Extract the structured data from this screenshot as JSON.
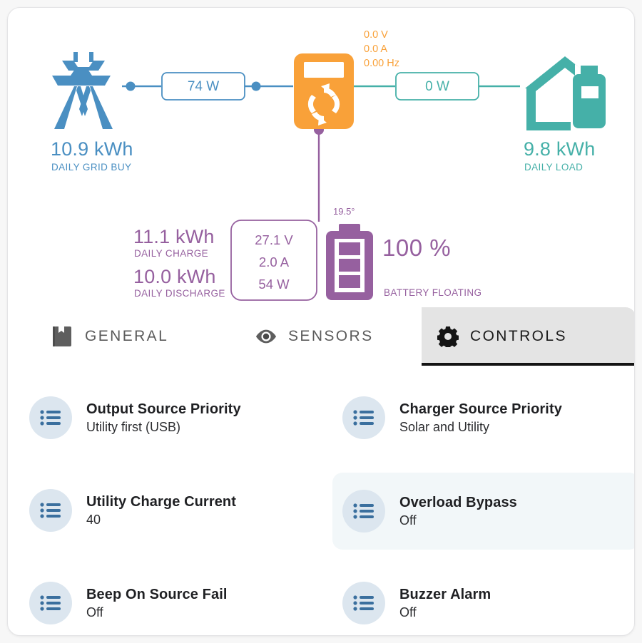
{
  "colors": {
    "grid": "#4a8fc2",
    "load": "#45b0a8",
    "battery": "#96609f",
    "inverter": "#f9a139",
    "icon_circle": "#dce6ef",
    "row_highlight": "#f2f7f9",
    "tab_active_bg": "#e4e4e4",
    "tab_underline": "#141414",
    "card_bg": "#ffffff",
    "page_bg": "#f7f7f7"
  },
  "diagram": {
    "grid": {
      "icon": "transmission-tower-icon",
      "value": "10.9 kWh",
      "caption": "DAILY GRID BUY",
      "flow_box": "74 W"
    },
    "inverter": {
      "icon": "inverter-icon",
      "ac_voltage": "0.0 V",
      "ac_current": "0.0 A",
      "ac_frequency": "0.00 Hz"
    },
    "load": {
      "icon": "house-load-icon",
      "value": "9.8 kWh",
      "caption": "DAILY LOAD",
      "flow_box": "0 W"
    },
    "battery": {
      "icon": "battery-icon",
      "daily_charge_value": "11.1 kWh",
      "daily_charge_caption": "DAILY CHARGE",
      "daily_discharge_value": "10.0 kWh",
      "daily_discharge_caption": "DAILY DISCHARGE",
      "voltage": "27.1 V",
      "current": "2.0 A",
      "power": "54 W",
      "temperature": "19.5°",
      "soc": "100 %",
      "status": "BATTERY FLOATING"
    }
  },
  "tabs": [
    {
      "label": "GENERAL",
      "icon": "book-icon",
      "active": false
    },
    {
      "label": "SENSORS",
      "icon": "eye-icon",
      "active": false
    },
    {
      "label": "CONTROLS",
      "icon": "gear-icon",
      "active": true
    }
  ],
  "controls": [
    {
      "title": "Output Source Priority",
      "value": "Utility first (USB)",
      "icon": "list-icon",
      "highlighted": false
    },
    {
      "title": "Charger Source Priority",
      "value": "Solar and Utility",
      "icon": "list-icon",
      "highlighted": false
    },
    {
      "title": "Utility Charge Current",
      "value": "40",
      "icon": "list-icon",
      "highlighted": false
    },
    {
      "title": "Overload Bypass",
      "value": "Off",
      "icon": "list-icon",
      "highlighted": true
    },
    {
      "title": "Beep On Source Fail",
      "value": "Off",
      "icon": "list-icon",
      "highlighted": false
    },
    {
      "title": "Buzzer Alarm",
      "value": "Off",
      "icon": "list-icon",
      "highlighted": false
    }
  ]
}
